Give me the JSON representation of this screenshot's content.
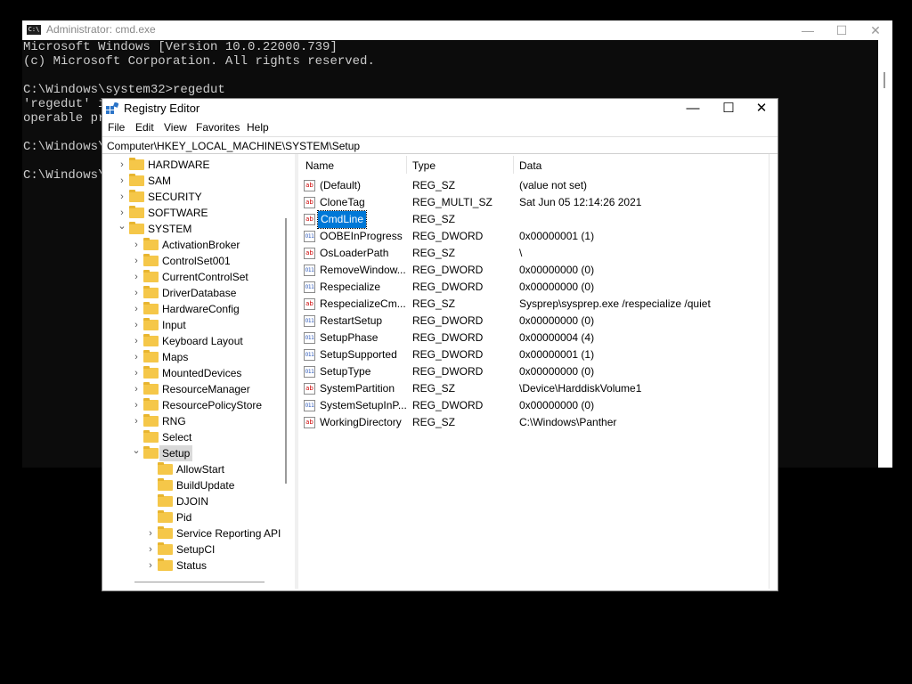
{
  "cmd": {
    "title": "Administrator: cmd.exe",
    "icon": "C:\\",
    "lines": [
      "Microsoft Windows [Version 10.0.22000.739]",
      "(c) Microsoft Corporation. All rights reserved.",
      "",
      "C:\\Windows\\system32>regedut",
      "'regedut' i",
      "operable pr",
      "",
      "C:\\Windows\\",
      "",
      "C:\\Windows\\"
    ],
    "controls": {
      "minimize": "—",
      "maximize": "☐",
      "close": "✕"
    }
  },
  "regedit": {
    "title": "Registry Editor",
    "controls": {
      "minimize": "—",
      "maximize": "☐",
      "close": "✕"
    },
    "menu": [
      "File",
      "Edit",
      "View",
      "Favorites",
      "Help"
    ],
    "address": "Computer\\HKEY_LOCAL_MACHINE\\SYSTEM\\Setup",
    "tree": [
      {
        "label": "HARDWARE",
        "level": 0,
        "expanded": false,
        "selected": false
      },
      {
        "label": "SAM",
        "level": 0,
        "expanded": false,
        "selected": false
      },
      {
        "label": "SECURITY",
        "level": 0,
        "expanded": false,
        "selected": false
      },
      {
        "label": "SOFTWARE",
        "level": 0,
        "expanded": false,
        "selected": false
      },
      {
        "label": "SYSTEM",
        "level": 0,
        "expanded": true,
        "selected": false
      },
      {
        "label": "ActivationBroker",
        "level": 1,
        "expanded": false,
        "selected": false
      },
      {
        "label": "ControlSet001",
        "level": 1,
        "expanded": false,
        "selected": false
      },
      {
        "label": "CurrentControlSet",
        "level": 1,
        "expanded": false,
        "selected": false
      },
      {
        "label": "DriverDatabase",
        "level": 1,
        "expanded": false,
        "selected": false
      },
      {
        "label": "HardwareConfig",
        "level": 1,
        "expanded": false,
        "selected": false
      },
      {
        "label": "Input",
        "level": 1,
        "expanded": false,
        "selected": false
      },
      {
        "label": "Keyboard Layout",
        "level": 1,
        "expanded": false,
        "selected": false
      },
      {
        "label": "Maps",
        "level": 1,
        "expanded": false,
        "selected": false
      },
      {
        "label": "MountedDevices",
        "level": 1,
        "expanded": false,
        "selected": false
      },
      {
        "label": "ResourceManager",
        "level": 1,
        "expanded": false,
        "selected": false
      },
      {
        "label": "ResourcePolicyStore",
        "level": 1,
        "expanded": false,
        "selected": false
      },
      {
        "label": "RNG",
        "level": 1,
        "expanded": false,
        "selected": false
      },
      {
        "label": "Select",
        "level": 1,
        "expanded": null,
        "selected": false
      },
      {
        "label": "Setup",
        "level": 1,
        "expanded": true,
        "selected": true
      },
      {
        "label": "AllowStart",
        "level": 2,
        "expanded": null,
        "selected": false
      },
      {
        "label": "BuildUpdate",
        "level": 2,
        "expanded": null,
        "selected": false
      },
      {
        "label": "DJOIN",
        "level": 2,
        "expanded": null,
        "selected": false
      },
      {
        "label": "Pid",
        "level": 2,
        "expanded": null,
        "selected": false
      },
      {
        "label": "Service Reporting API",
        "level": 2,
        "expanded": false,
        "selected": false
      },
      {
        "label": "SetupCI",
        "level": 2,
        "expanded": false,
        "selected": false
      },
      {
        "label": "Status",
        "level": 2,
        "expanded": false,
        "selected": false
      }
    ],
    "columns": {
      "name": "Name",
      "type": "Type",
      "data": "Data"
    },
    "values": [
      {
        "name": "(Default)",
        "type": "REG_SZ",
        "data": "(value not set)",
        "kind": "string",
        "selected": false
      },
      {
        "name": "CloneTag",
        "type": "REG_MULTI_SZ",
        "data": "Sat Jun 05 12:14:26 2021",
        "kind": "string",
        "selected": false
      },
      {
        "name": "CmdLine",
        "type": "REG_SZ",
        "data": "",
        "kind": "string",
        "selected": true
      },
      {
        "name": "OOBEInProgress",
        "type": "REG_DWORD",
        "data": "0x00000001 (1)",
        "kind": "binary",
        "selected": false
      },
      {
        "name": "OsLoaderPath",
        "type": "REG_SZ",
        "data": "\\",
        "kind": "string",
        "selected": false
      },
      {
        "name": "RemoveWindow...",
        "type": "REG_DWORD",
        "data": "0x00000000 (0)",
        "kind": "binary",
        "selected": false
      },
      {
        "name": "Respecialize",
        "type": "REG_DWORD",
        "data": "0x00000000 (0)",
        "kind": "binary",
        "selected": false
      },
      {
        "name": "RespecializeCm...",
        "type": "REG_SZ",
        "data": "Sysprep\\sysprep.exe /respecialize /quiet",
        "kind": "string",
        "selected": false
      },
      {
        "name": "RestartSetup",
        "type": "REG_DWORD",
        "data": "0x00000000 (0)",
        "kind": "binary",
        "selected": false
      },
      {
        "name": "SetupPhase",
        "type": "REG_DWORD",
        "data": "0x00000004 (4)",
        "kind": "binary",
        "selected": false
      },
      {
        "name": "SetupSupported",
        "type": "REG_DWORD",
        "data": "0x00000001 (1)",
        "kind": "binary",
        "selected": false
      },
      {
        "name": "SetupType",
        "type": "REG_DWORD",
        "data": "0x00000000 (0)",
        "kind": "binary",
        "selected": false
      },
      {
        "name": "SystemPartition",
        "type": "REG_SZ",
        "data": "\\Device\\HarddiskVolume1",
        "kind": "string",
        "selected": false
      },
      {
        "name": "SystemSetupInP...",
        "type": "REG_DWORD",
        "data": "0x00000000 (0)",
        "kind": "binary",
        "selected": false
      },
      {
        "name": "WorkingDirectory",
        "type": "REG_SZ",
        "data": "C:\\Windows\\Panther",
        "kind": "string",
        "selected": false
      }
    ],
    "icons": {
      "string": "ab",
      "binary": "011"
    }
  }
}
